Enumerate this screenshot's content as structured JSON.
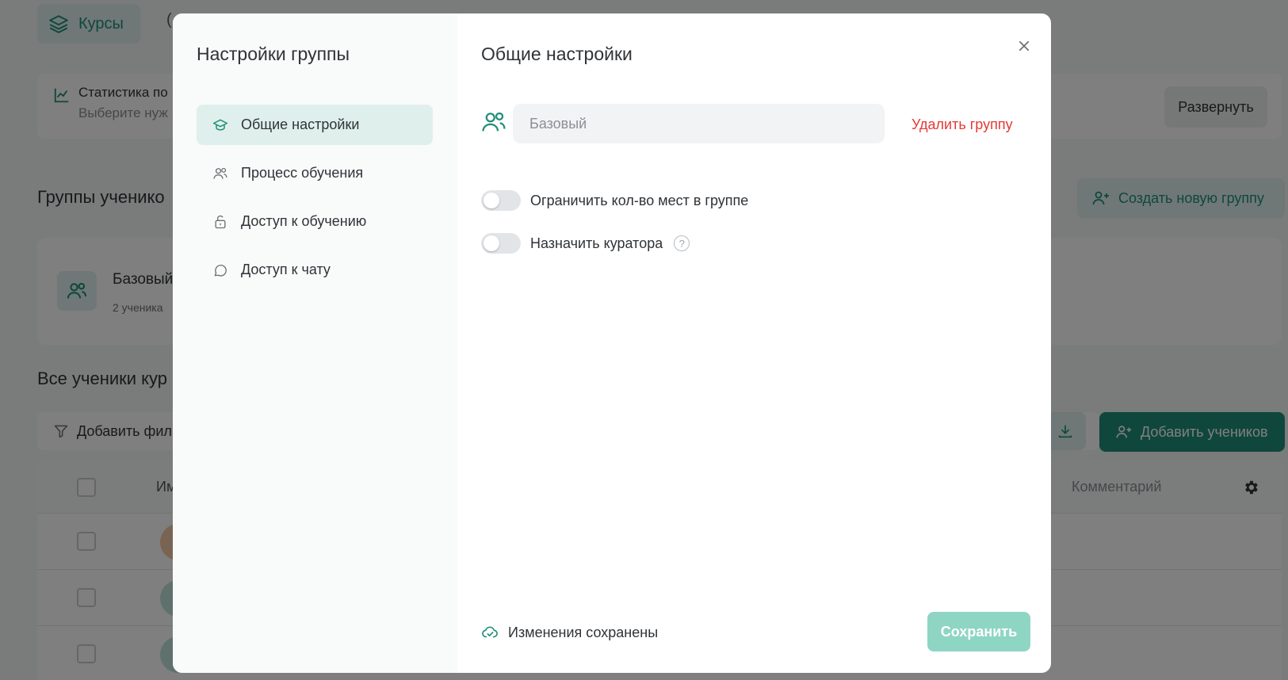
{
  "background": {
    "tabs": {
      "courses_label": "Курсы",
      "second_label": "("
    },
    "stats": {
      "title": "Статистика по",
      "subtitle": "Выберите нуж"
    },
    "expand_label": "Развернуть",
    "groups_title": "Группы ученико",
    "create_group_label": "Создать новую группу",
    "group_card": {
      "name": "Базовый",
      "count": "2 ученика"
    },
    "all_students_title": "Все ученики кур",
    "filter_label": "Добавить филь",
    "add_students_label": "Добавить учеников",
    "table": {
      "col_name": "Им",
      "col_comment": "Комментарий"
    }
  },
  "modal": {
    "sidebar_title": "Настройки группы",
    "sidebar_items": [
      {
        "label": "Общие настройки",
        "icon": "graduation-cap-icon",
        "active": true
      },
      {
        "label": "Процесс обучения",
        "icon": "users-icon",
        "active": false
      },
      {
        "label": "Доступ к обучению",
        "icon": "lock-icon",
        "active": false
      },
      {
        "label": "Доступ к чату",
        "icon": "chat-icon",
        "active": false
      }
    ],
    "main_title": "Общие настройки",
    "group_name_value": "",
    "group_name_placeholder": "Базовый",
    "delete_label": "Удалить группу",
    "toggles": [
      {
        "label": "Ограничить кол-во мест в группе",
        "on": false
      },
      {
        "label": "Назначить куратора",
        "on": false,
        "help": "?"
      }
    ],
    "saved_status": "Изменения сохранены",
    "save_label": "Сохранить"
  },
  "colors": {
    "accent": "#1f8f78",
    "accent_light": "#dff0ec",
    "danger": "#e53935",
    "save_disabled": "#8fd5c4"
  }
}
